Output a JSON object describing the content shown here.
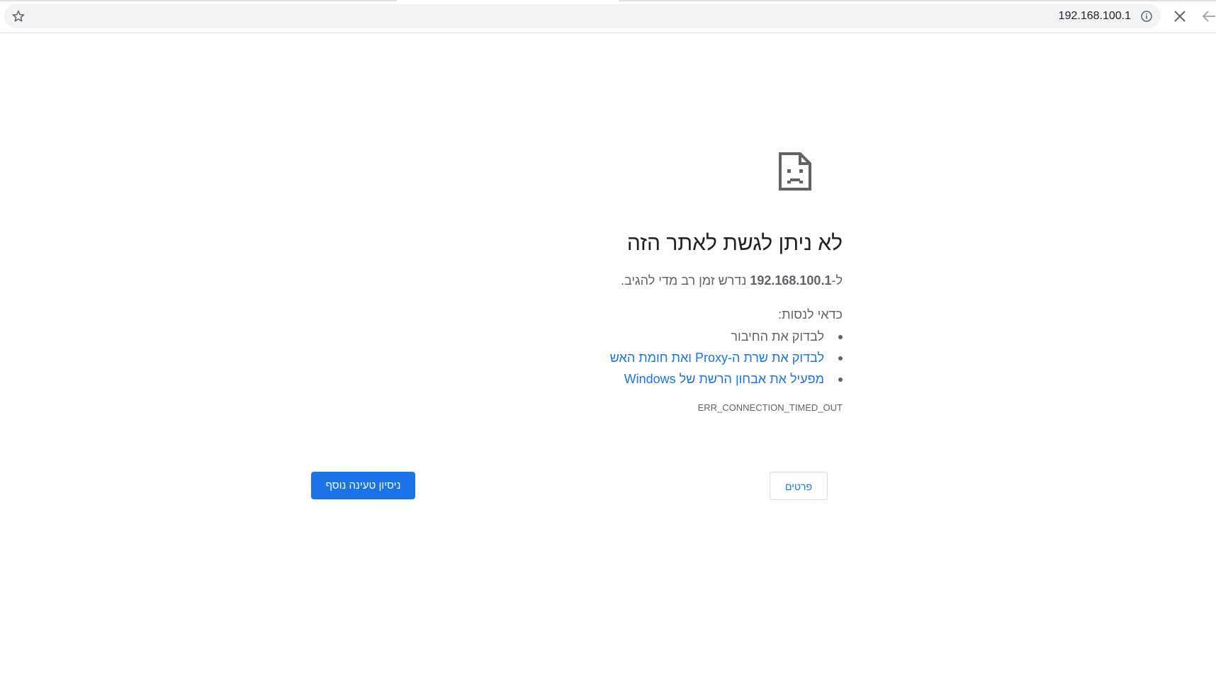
{
  "toolbar": {
    "url": "192.168.100.1",
    "icons": [
      "star-icon",
      "info-icon",
      "close-icon",
      "back-arrow-icon"
    ]
  },
  "error": {
    "icon": "sad-page-icon",
    "title": "לא ניתן לגשת לאתר הזה",
    "message_prefix": "ל-",
    "host": "192.168.100.1",
    "message_suffix": " נדרש זמן רב מדי להגיב.",
    "try_label": "כדאי לנסות:",
    "suggestions": [
      {
        "label": "לבדוק את החיבור"
      },
      {
        "label": "לבדוק את שרת ה-Proxy ואת חומת האש"
      },
      {
        "label": "מפעיל את אבחון הרשת של Windows"
      }
    ],
    "code": "ERR_CONNECTION_TIMED_OUT"
  },
  "buttons": {
    "details": "פרטים",
    "reload": "ניסיון טעינה נוסף"
  },
  "colors": {
    "accent": "#1a73e8",
    "text": "#202124",
    "secondary": "#5f6368"
  }
}
